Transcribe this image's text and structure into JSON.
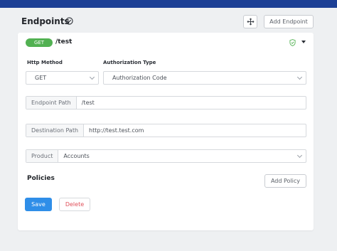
{
  "header": {
    "title": "Endpoints",
    "add_endpoint_label": "Add Endpoint",
    "info_icon": "circle-check-icon",
    "expand_icon": "plus-cross-icon"
  },
  "endpoint": {
    "method_badge": "GET",
    "path": "/test",
    "status_icon": "shield-check-icon",
    "toggle_icon": "caret-down-icon"
  },
  "form": {
    "http_method_label": "Http Method",
    "http_method_value": "GET",
    "authorization_type_label": "Authorization Type",
    "authorization_type_value": "Authorization Code",
    "endpoint_path_label": "Endpoint Path",
    "endpoint_path_value": "/test",
    "destination_path_label": "Destination Path",
    "destination_path_value": "http://test.test.com",
    "product_label": "Product",
    "product_value": "Accounts"
  },
  "policies": {
    "title": "Policies",
    "add_policy_label": "Add Policy"
  },
  "actions": {
    "save_label": "Save",
    "delete_label": "Delete"
  },
  "colors": {
    "topbar": "#1c3f95",
    "method_badge": "#52b152",
    "save": "#2f8ee8",
    "delete_text": "#e0505a"
  }
}
